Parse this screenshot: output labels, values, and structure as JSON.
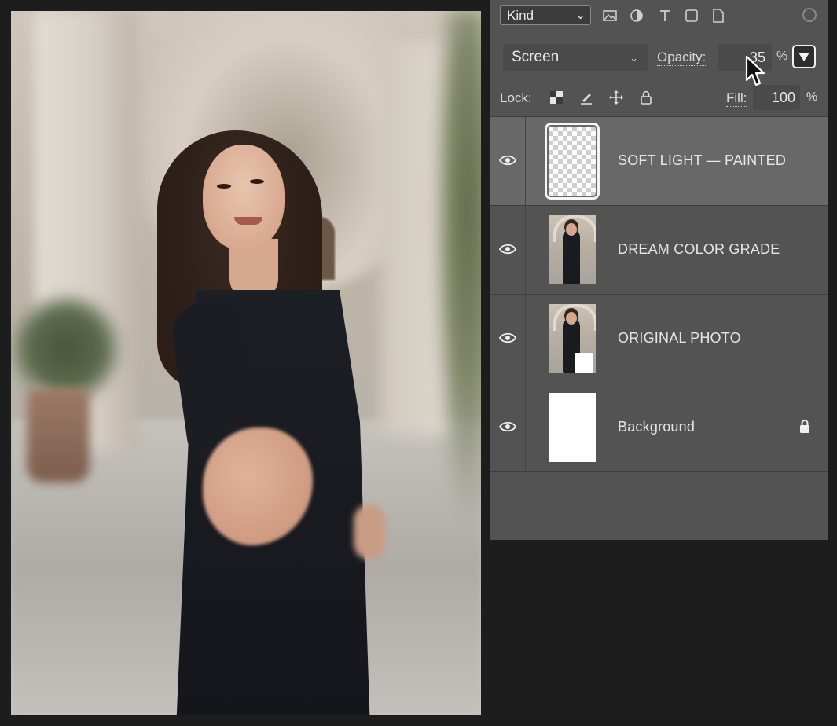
{
  "canvas": {
    "image": "woman-in-black-dress-arcade-photo"
  },
  "layers_panel": {
    "filter": {
      "kind_value": "Kind",
      "icons": [
        "image-filter-icon",
        "adjustment-filter-icon",
        "type-filter-icon",
        "shape-filter-icon",
        "smart-object-filter-icon",
        "filter-toggle-icon"
      ]
    },
    "blend_mode": "Screen",
    "opacity_label": "Opacity:",
    "opacity_value": "35",
    "opacity_unit": "%",
    "lock_label": "Lock:",
    "lock_icons": [
      "lock-transparent-pixels-icon",
      "lock-image-pixels-icon",
      "lock-position-icon",
      "lock-all-icon"
    ],
    "fill_label": "Fill:",
    "fill_value": "100",
    "fill_unit": "%",
    "layers": [
      {
        "name": "SOFT LIGHT — PAINTED",
        "visible": true,
        "selected": true,
        "thumbnail": "transparent"
      },
      {
        "name": "DREAM COLOR GRADE",
        "visible": true,
        "selected": false,
        "thumbnail": "photo"
      },
      {
        "name": "ORIGINAL PHOTO",
        "visible": true,
        "selected": false,
        "thumbnail": "photo"
      },
      {
        "name": "Background",
        "visible": true,
        "selected": false,
        "thumbnail": "white",
        "locked": true
      }
    ]
  },
  "colors": {
    "panel_bg": "#535353",
    "selected_layer_bg": "#686868",
    "app_bg": "#1d1d1d"
  }
}
